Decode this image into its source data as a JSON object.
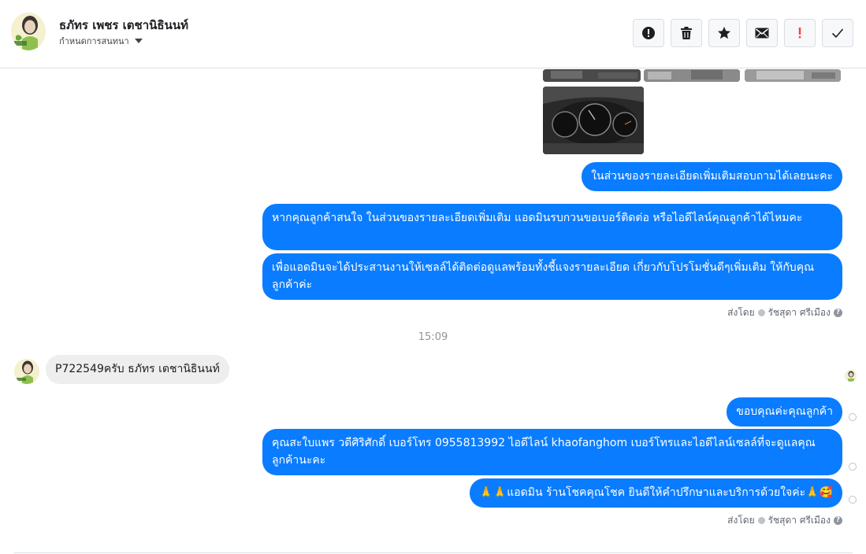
{
  "header": {
    "contact_name": "ธภัทร เพชร เตชานิธินนท์",
    "assign_label": "กำหนดการสนทนา",
    "actions": [
      {
        "name": "report-button",
        "icon": "alert-circle-icon"
      },
      {
        "name": "delete-button",
        "icon": "trash-icon"
      },
      {
        "name": "star-button",
        "icon": "star-icon"
      },
      {
        "name": "mark-unread-button",
        "icon": "envelope-icon"
      },
      {
        "name": "spam-button",
        "icon": "exclamation-icon"
      },
      {
        "name": "done-button",
        "icon": "check-icon"
      }
    ]
  },
  "messages": {
    "out1": "ในส่วนของรายละเอียดเพิ่มเติมสอบถามได้เลยนะคะ",
    "out2": "หากคุณลูกค้าสนใจ ในส่วนของรายละเอียดเพิ่มเติม แอดมินรบกวนขอเบอร์ติดต่อ หรือไอดีไลน์คุณลูกค้าได้ไหมคะ",
    "out3": "เพื่อแอดมินจะได้ประสานงานให้เซลล์ได้ติดต่อดูแลพร้อมทั้งชี้แจงรายละเอียด เกี่ยวกับโปรโมชั่นดีๆเพิ่มเติม ให้กับคุณลูกค้าค่ะ",
    "sent_by_1_label": "ส่งโดย",
    "sent_by_1_name": "รัชสุดา ศรีเมือง",
    "timestamp": "15:09",
    "in1": "P722549ครับ ธภัทร เตชานิธินนท์",
    "out4": "ขอบคุณค่ะคุณลูกค้า",
    "out5": "คุณสะใบแพร วดีศิริศักดิ์ เบอร์โทร 0955813992  ไอดีไลน์  khaofanghom   เบอร์โทรและไอดีไลน์เซลล์ที่จะดูแลคุณลูกค้านะคะ",
    "out6": "🙏🙏แอดมิน ร้านโชคคุณโชค ยินดีให้คำปรึกษาและบริการด้วยใจค่ะ🙏🥰",
    "sent_by_2_label": "ส่งโดย",
    "sent_by_2_name": "รัชสุดา ศรีเมือง"
  },
  "colors": {
    "accent": "#0a7cff",
    "incoming_bubble": "#eeeeee",
    "muted_text": "#606770"
  }
}
